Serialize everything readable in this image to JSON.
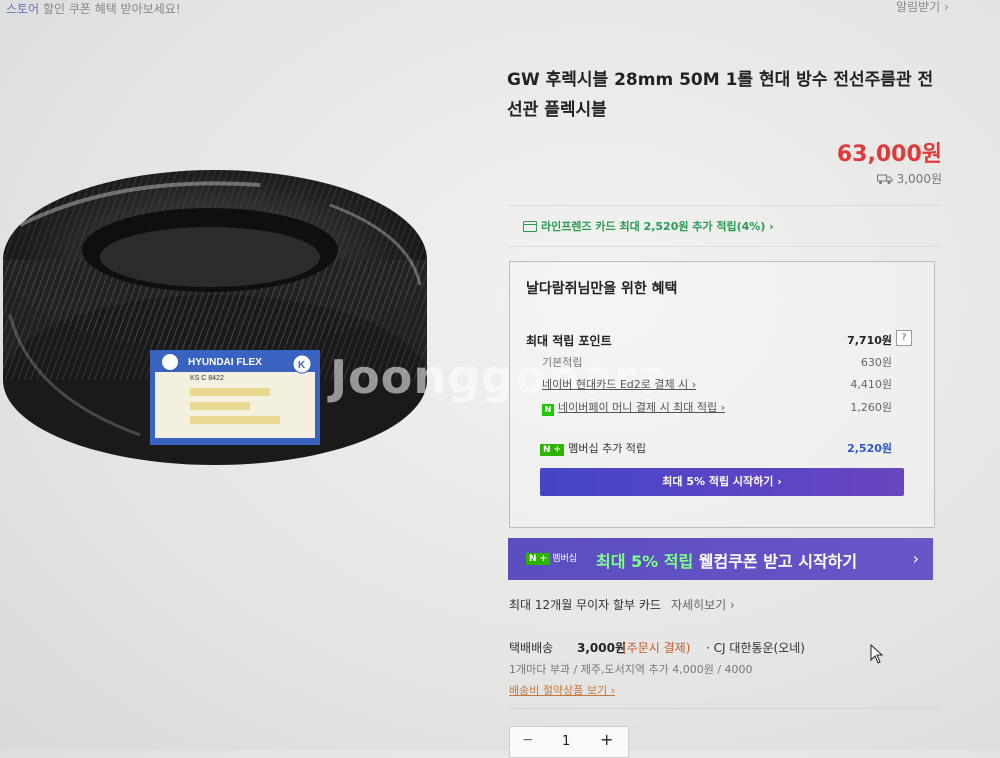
{
  "top": {
    "left_text_prefix": "스토어",
    "left_text": "할인 쿠폰 혜택 받아보세요!",
    "right_text": "알림받기 ›"
  },
  "watermark": "Joonggonara",
  "product": {
    "title": "GW 후렉시블 28mm 50M 1롤 현대 방수 전선주름관 전선관 플렉시블",
    "price": "63,000원",
    "shipping_fee": "3,000원",
    "image_label_brand": "HYUNDAI FLEX",
    "image_label_sub": "KS C 8422",
    "image_label_mark": "K"
  },
  "card_banner": {
    "text": "라인프렌즈 카드 최대 2,520원 추가 적립(4%) ›"
  },
  "benefits": {
    "title": "날다람쥐님만을 위한 혜택",
    "max_points_label": "최대 적립 포인트",
    "max_points_value": "7,710원",
    "help_icon": "?",
    "rows": [
      {
        "label": "기본적립",
        "value": "630원"
      },
      {
        "label": "네이버 현대카드 Ed2로 결제 시 ›",
        "value": "4,410원"
      },
      {
        "label": "네이버페이 머니 결제 시 최대 적립 ›",
        "value": "1,260원"
      }
    ],
    "npay_badge": "N",
    "membership_badge": "N +",
    "membership_label": "멤버십 추가 적립",
    "membership_value": "2,520원",
    "start_button": "최대 5% 적립 시작하기 ›"
  },
  "welcome_banner": {
    "badge_n": "N +",
    "badge_text": "멤버십",
    "highlight": "최대 5% 적립",
    "text": " 웰컴쿠폰 받고 시작하기",
    "chevron": "›"
  },
  "installment": {
    "text": "최대 12개월 무이자 할부 카드",
    "more": "자세히보기 ›"
  },
  "delivery": {
    "label": "택배배송",
    "fee": "3,000원",
    "note": "(주문시 결제)",
    "carrier": "· CJ 대한통운(오네)",
    "extra": "1개마다 부과 / 제주,도서지역 추가 4,000원 / 4000",
    "link": "배송비 절약상품 보기 ›"
  },
  "quantity": {
    "minus": "−",
    "value": "1",
    "plus": "+"
  },
  "colors": {
    "price_red": "#e03a3a",
    "card_green": "#2a9a55",
    "member_blue": "#3057c8",
    "banner_purple": "#5a4ec0"
  }
}
